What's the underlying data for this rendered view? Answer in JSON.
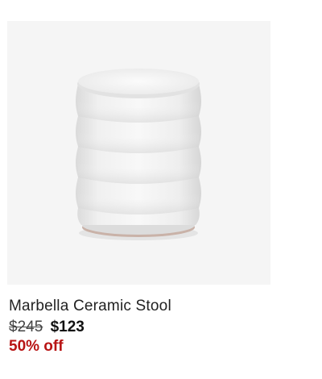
{
  "product": {
    "image_alt": "ceramic-stool-photo",
    "title": "Marbella Ceramic Stool",
    "price_original": "$245",
    "price_sale": "$123",
    "discount_label": "50% off"
  },
  "colors": {
    "image_background": "#f5f5f5",
    "discount_red": "#b81414",
    "text_dark": "#222222"
  }
}
